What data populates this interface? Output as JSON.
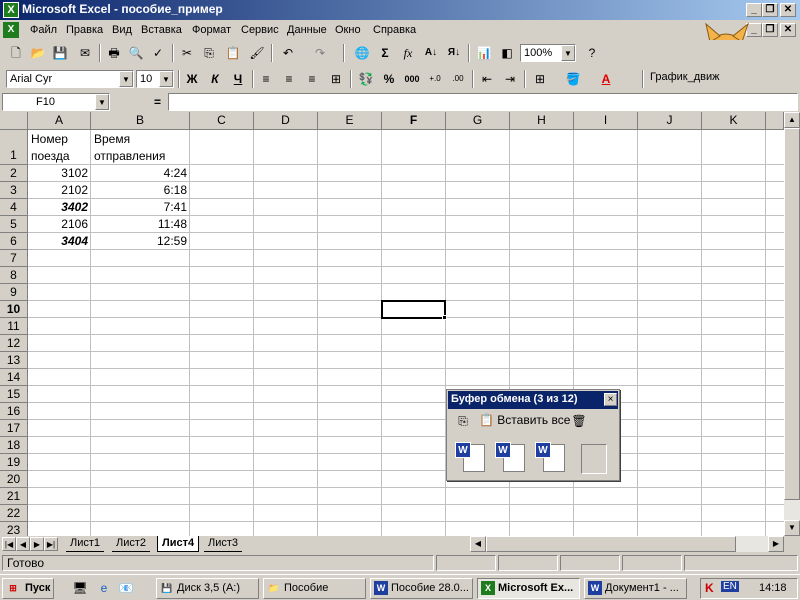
{
  "window": {
    "title": "Microsoft Excel - пособие_пример"
  },
  "menu": [
    "Файл",
    "Правка",
    "Вид",
    "Вставка",
    "Формат",
    "Сервис",
    "Данные",
    "Окно",
    "Справка"
  ],
  "toolbar": {
    "zoom": "100%",
    "font_name": "Arial Cyr",
    "font_size": "10",
    "bold": "Ж",
    "italic": "К",
    "underline": "Ч",
    "percent": "%",
    "thousands": "000",
    "sigma": "Σ",
    "fx": "fx",
    "chart_toolbar": "График_движ"
  },
  "formula_bar": {
    "name_box": "F10",
    "equals": "=",
    "value": ""
  },
  "columns": [
    "A",
    "B",
    "C",
    "D",
    "E",
    "F",
    "G",
    "H",
    "I",
    "J",
    "K"
  ],
  "rows": [
    "1",
    "2",
    "3",
    "4",
    "5",
    "6",
    "7",
    "8",
    "9",
    "10",
    "11",
    "12",
    "13",
    "14",
    "15",
    "16",
    "17",
    "18",
    "19",
    "20",
    "21",
    "22",
    "23"
  ],
  "cells": {
    "a1_line1": "Номер",
    "a1_line2": "поезда",
    "b1_line1": "Время",
    "b1_line2": "отправления",
    "a2": "3102",
    "b2": "4:24",
    "a3": "2102",
    "b3": "6:18",
    "a4": "3402",
    "b4": "7:41",
    "a5": "2106",
    "b5": "11:48",
    "a6": "3404",
    "b6": "12:59"
  },
  "active_cell": "F10",
  "sheet_tabs": [
    "Лист1",
    "Лист2",
    "Лист4",
    "Лист3"
  ],
  "active_sheet": "Лист4",
  "status": "Готово",
  "clipboard": {
    "title": "Буфер обмена (3 из 12)",
    "paste_all": "Вставить все",
    "close": "×"
  },
  "taskbar": {
    "start": "Пуск",
    "tasks": [
      "Диск 3,5 (A:)",
      "Пособие",
      "Пособие 28.0...",
      "Microsoft Ex...",
      "Документ1 - ..."
    ],
    "lang": "EN",
    "clock": "14:18"
  },
  "colors": {
    "title_bar": "#0a246a",
    "excel_green": "#1e7b1e",
    "word_blue": "#1f3fa0"
  }
}
